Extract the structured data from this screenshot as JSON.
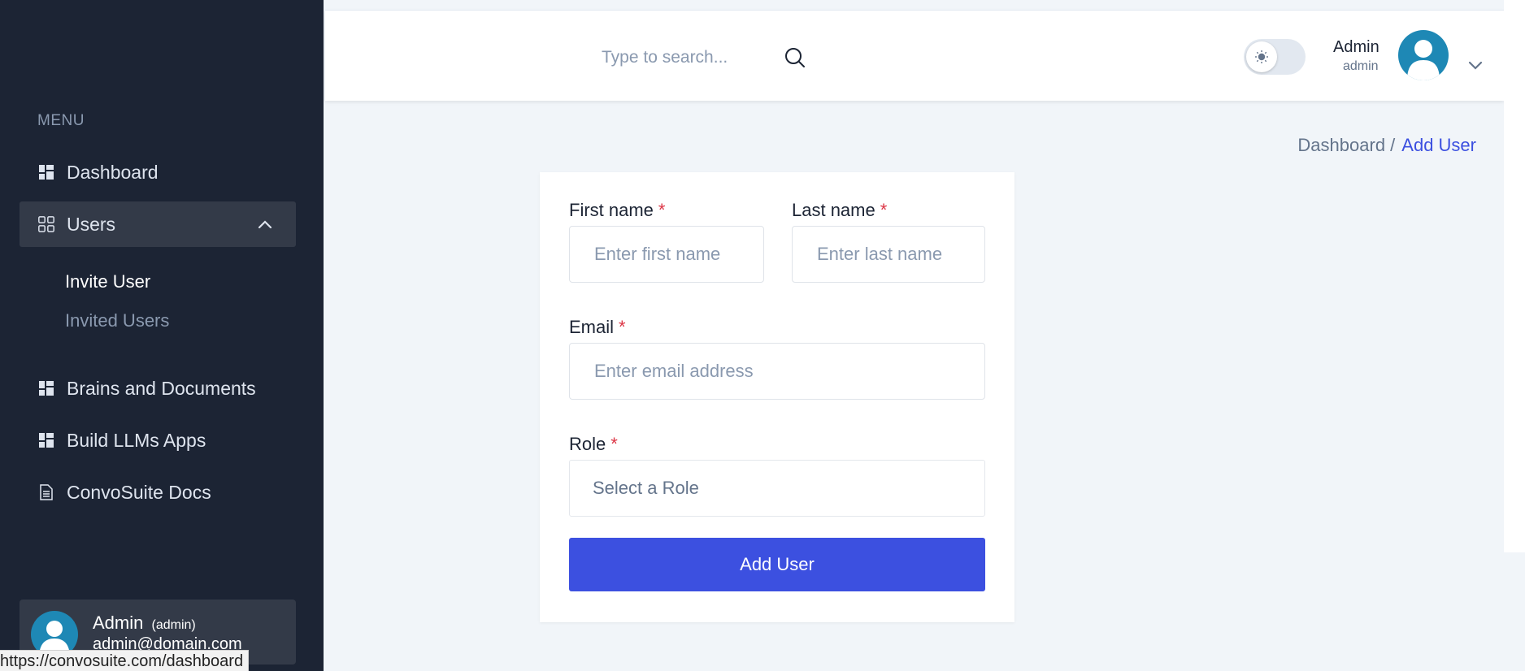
{
  "sidebar": {
    "menu_heading": "MENU",
    "items": {
      "dashboard": "Dashboard",
      "users": "Users",
      "brains": "Brains and Documents",
      "llm_apps": "Build LLMs Apps",
      "docs": "ConvoSuite Docs"
    },
    "users_submenu": [
      "Invite User",
      "Invited Users"
    ],
    "profile": {
      "name": "Admin",
      "role": "(admin)",
      "email": "admin@domain.com"
    }
  },
  "status_bar": {
    "url": "https://convosuite.com/dashboard"
  },
  "header": {
    "search_placeholder": "Type to search...",
    "user_name": "Admin",
    "user_role": "admin"
  },
  "breadcrumb": {
    "parent": "Dashboard /",
    "current": "Add User"
  },
  "form": {
    "first_name_label": "First name",
    "first_name_placeholder": "Enter first name",
    "last_name_label": "Last name",
    "last_name_placeholder": "Enter last name",
    "email_label": "Email",
    "email_placeholder": "Enter email address",
    "role_label": "Role",
    "role_placeholder": "Select a Role",
    "required_mark": "*",
    "submit_label": "Add User"
  },
  "colors": {
    "sidebar_bg": "#1c2434",
    "primary": "#3c50e0",
    "required": "#dc3545",
    "avatar": "#1e88b5"
  }
}
